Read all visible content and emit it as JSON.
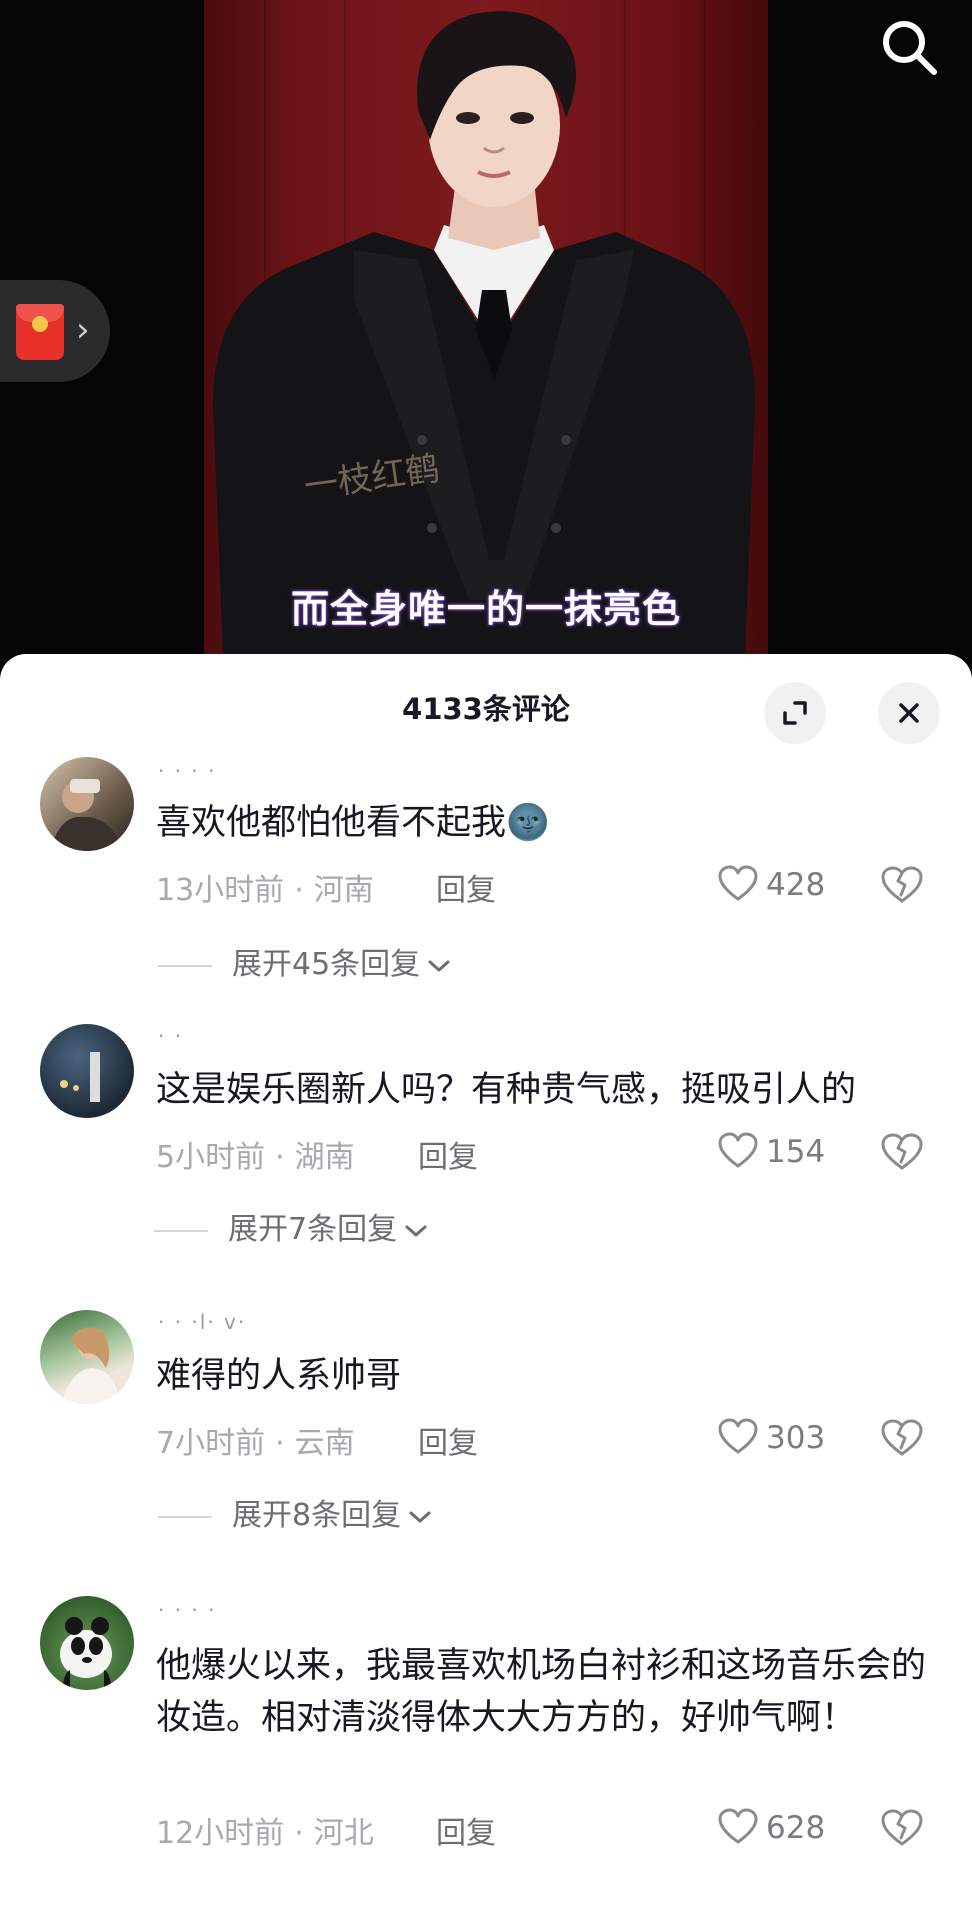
{
  "video": {
    "subtitle": "而全身唯一的一抹亮色",
    "watermark": "一枝红鹤"
  },
  "sheet": {
    "title": "4133条评论"
  },
  "comments": [
    {
      "username": "· · · · ",
      "text": "喜欢他都怕他看不起我🌚",
      "time": "13小时前",
      "location": "河南",
      "reply_label": "回复",
      "likes": "428",
      "expand_replies": "展开45条回复"
    },
    {
      "username": "· ·",
      "text": "这是娱乐圈新人吗？有种贵气感，挺吸引人的",
      "time": "5小时前",
      "location": "湖南",
      "reply_label": "回复",
      "likes": "154",
      "expand_replies": "展开7条回复"
    },
    {
      "username": "· · ·l· v·",
      "text": "难得的人系帅哥",
      "time": "7小时前",
      "location": "云南",
      "reply_label": "回复",
      "likes": "303",
      "expand_replies": "展开8条回复"
    },
    {
      "username": "· · · ·",
      "text": "他爆火以来，我最喜欢机场白衬衫和这场音乐会的妆造。相对清淡得体大大方方的，好帅气啊！",
      "time": "12小时前",
      "location": "河北",
      "reply_label": "回复",
      "likes": "628"
    }
  ],
  "icons": {
    "search": "search-icon",
    "red_packet": "red-packet-icon",
    "expand": "expand-icon",
    "close": "close-icon",
    "like": "heart-outline-icon",
    "dislike": "broken-heart-icon",
    "chevron": "chevron-down-icon"
  },
  "colors": {
    "sheet_bg": "#ffffff",
    "text_primary": "#161823",
    "text_secondary": "#a8a8ad",
    "curtain_red": "#7c1a1c",
    "red_packet": "#e8302a"
  }
}
